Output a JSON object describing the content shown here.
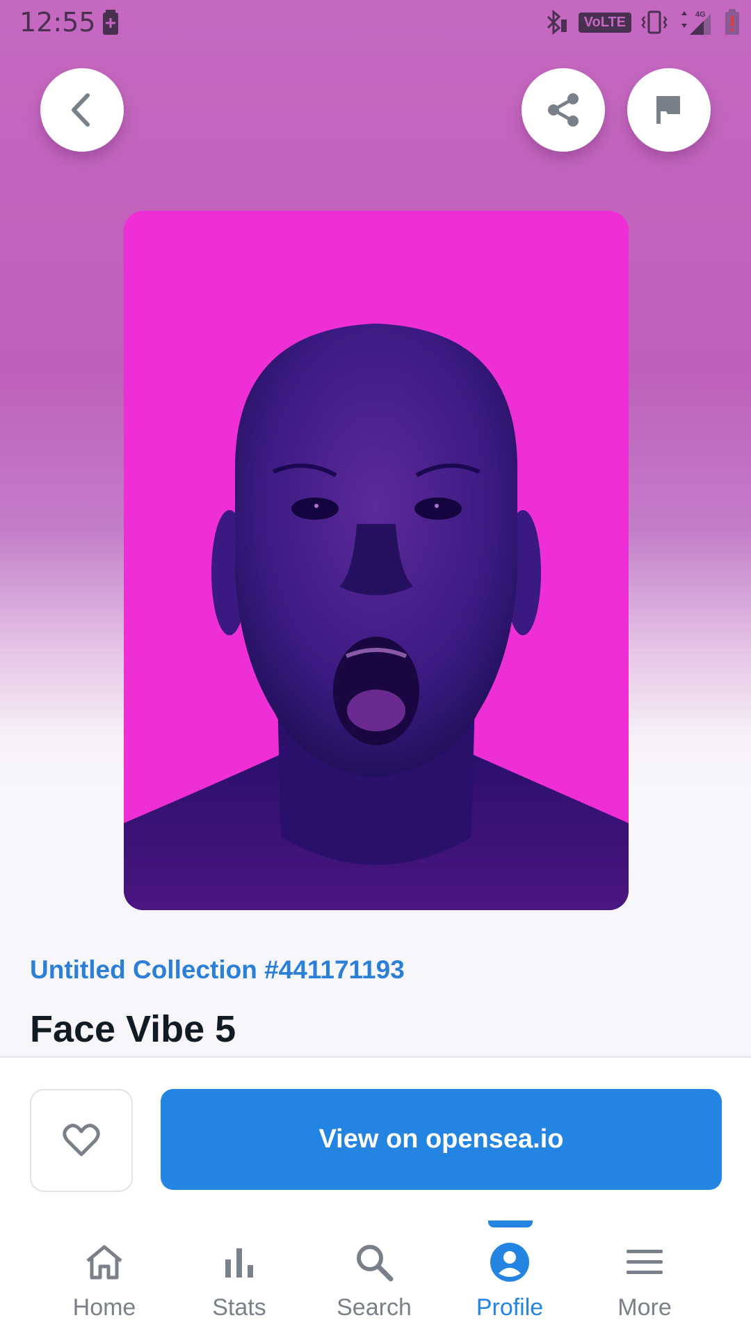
{
  "status_bar": {
    "time": "12:55",
    "network_badge": "VoLTE",
    "network_type": "4G",
    "icons": [
      "battery-charging-icon",
      "bluetooth-icon",
      "volte-icon",
      "vibrate-icon",
      "signal-4g-icon",
      "battery-alert-icon"
    ]
  },
  "header": {
    "icons": [
      "chevron-left-icon",
      "share-icon",
      "flag-icon"
    ]
  },
  "item": {
    "collection": "Untitled Collection #441171193",
    "title": "Face Vibe 5"
  },
  "actions": {
    "view_label": "View on opensea.io",
    "favorite_icon": "heart-icon",
    "accent": "#2384e1"
  },
  "nav": {
    "items": [
      {
        "label": "Home",
        "icon": "home-icon"
      },
      {
        "label": "Stats",
        "icon": "bar-chart-icon"
      },
      {
        "label": "Search",
        "icon": "search-icon"
      },
      {
        "label": "Profile",
        "icon": "profile-icon",
        "active": true
      },
      {
        "label": "More",
        "icon": "menu-icon"
      }
    ]
  },
  "colors": {
    "hero_top": "#c568c0",
    "artwork_bg": "#ee2fd6",
    "link": "#2b7fd6",
    "nav_inactive": "#7a8089"
  }
}
